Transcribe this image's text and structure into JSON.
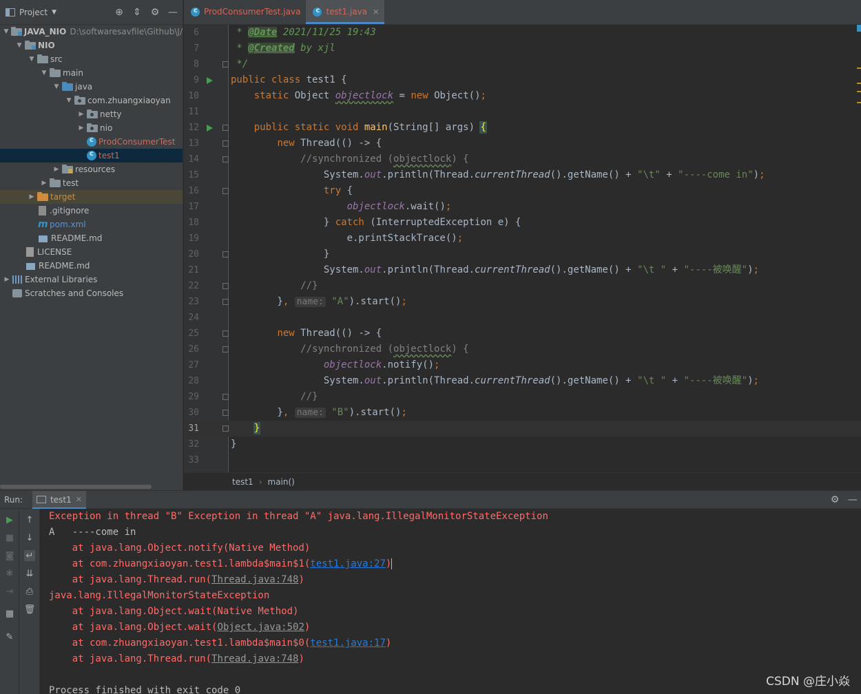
{
  "project_panel": {
    "title": "Project",
    "tree": [
      {
        "depth": 0,
        "arrow": "down",
        "icon": "module-folder",
        "label": "JAVA_NIO",
        "bold": true,
        "path": "D:\\softwaresavfile\\Github\\J/"
      },
      {
        "depth": 1,
        "arrow": "down",
        "icon": "module-folder",
        "label": "NIO",
        "bold": true
      },
      {
        "depth": 2,
        "arrow": "down",
        "icon": "folder",
        "label": "src"
      },
      {
        "depth": 3,
        "arrow": "down",
        "icon": "folder",
        "label": "main"
      },
      {
        "depth": 4,
        "arrow": "down",
        "icon": "folder-blue",
        "label": "java"
      },
      {
        "depth": 5,
        "arrow": "down",
        "icon": "package",
        "label": "com.zhuangxiaoyan"
      },
      {
        "depth": 6,
        "arrow": "right",
        "icon": "package",
        "label": "netty"
      },
      {
        "depth": 6,
        "arrow": "right",
        "icon": "package",
        "label": "nio"
      },
      {
        "depth": 6,
        "arrow": "none",
        "icon": "class",
        "label": "ProdConsumerTest",
        "color": "red"
      },
      {
        "depth": 6,
        "arrow": "none",
        "icon": "class",
        "label": "test1",
        "color": "red",
        "selected": true
      },
      {
        "depth": 4,
        "arrow": "right",
        "icon": "folder-res",
        "label": "resources"
      },
      {
        "depth": 3,
        "arrow": "right",
        "icon": "folder",
        "label": "test"
      },
      {
        "depth": 2,
        "arrow": "right",
        "icon": "folder-orange",
        "label": "target",
        "color": "orange",
        "excluded": true
      },
      {
        "depth": 2,
        "arrow": "none",
        "icon": "ignore-file",
        "label": ".gitignore"
      },
      {
        "depth": 2,
        "arrow": "none",
        "icon": "maven",
        "label": "pom.xml",
        "color": "blue"
      },
      {
        "depth": 2,
        "arrow": "none",
        "icon": "md-file",
        "label": "README.md"
      },
      {
        "depth": 1,
        "arrow": "none",
        "icon": "license-file",
        "label": "LICENSE"
      },
      {
        "depth": 1,
        "arrow": "none",
        "icon": "md-file",
        "label": "README.md"
      },
      {
        "depth": 0,
        "arrow": "right",
        "icon": "library",
        "label": "External Libraries"
      },
      {
        "depth": 0,
        "arrow": "none",
        "icon": "scratch",
        "label": "Scratches and Consoles"
      }
    ]
  },
  "editor": {
    "tabs": [
      {
        "label": "ProdConsumerTest.java",
        "active": false
      },
      {
        "label": "test1.java",
        "active": true
      }
    ],
    "current_line": 31,
    "breadcrumb": [
      "test1",
      "main()"
    ]
  },
  "run_panel": {
    "label": "Run:",
    "tab": "test1",
    "console": [
      {
        "type": "err",
        "text": "Exception in thread \"B\" Exception in thread \"A\" java.lang.IllegalMonitorStateException"
      },
      {
        "type": "out",
        "text": "A   ----come in"
      },
      {
        "type": "err",
        "text": "    at java.lang.Object.notify(Native Method)"
      },
      {
        "type": "err",
        "text": "    at com.zhuangxiaoyan.test1.lambda$main$1(",
        "link": "test1.java:27",
        "link_style": "blue",
        "tail": ")",
        "caret": true
      },
      {
        "type": "err",
        "text": "    at java.lang.Thread.run(",
        "link": "Thread.java:748",
        "link_style": "gray",
        "tail": ")"
      },
      {
        "type": "err",
        "text": "java.lang.IllegalMonitorStateException"
      },
      {
        "type": "err",
        "text": "    at java.lang.Object.wait(Native Method)"
      },
      {
        "type": "err",
        "text": "    at java.lang.Object.wait(",
        "link": "Object.java:502",
        "link_style": "gray",
        "tail": ")"
      },
      {
        "type": "err",
        "text": "    at com.zhuangxiaoyan.test1.lambda$main$0(",
        "link": "test1.java:17",
        "link_style": "blue",
        "tail": ")"
      },
      {
        "type": "err",
        "text": "    at java.lang.Thread.run(",
        "link": "Thread.java:748",
        "link_style": "gray",
        "tail": ")"
      },
      {
        "type": "out",
        "text": ""
      },
      {
        "type": "out",
        "text": "Process finished with exit code 0"
      }
    ]
  },
  "watermark": "CSDN @庄小焱"
}
